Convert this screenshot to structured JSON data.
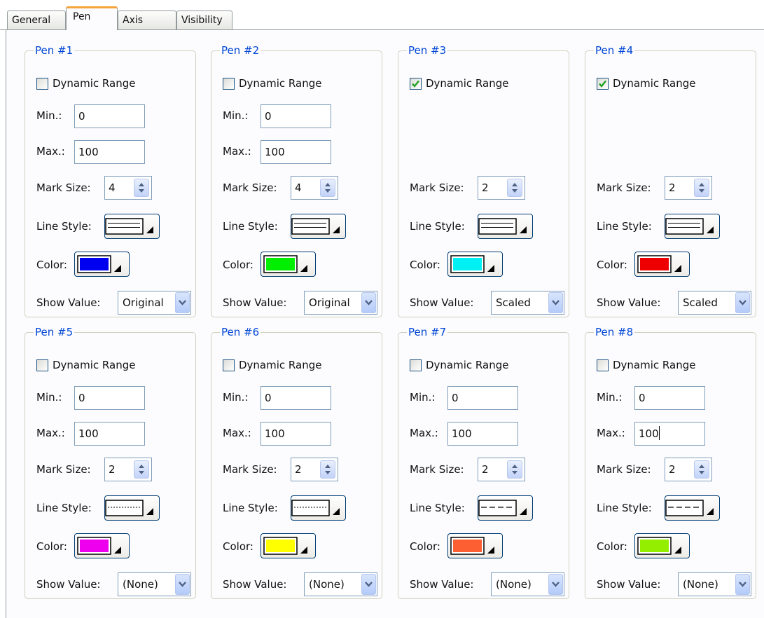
{
  "tabs": [
    {
      "label": "General"
    },
    {
      "label": "Pen",
      "active": true
    },
    {
      "label": "Axis"
    },
    {
      "label": "Visibility"
    }
  ],
  "labels": {
    "dynamic_range": "Dynamic Range",
    "min": "Min.:",
    "max": "Max.:",
    "mark_size": "Mark Size:",
    "line_style": "Line Style:",
    "color": "Color:",
    "show_value": "Show Value:"
  },
  "pens": [
    {
      "title": "Pen #1",
      "dynamic_range": false,
      "min": "0",
      "max": "100",
      "mark_size": "4",
      "line_style": "solid",
      "color": "#0000f0",
      "show_value": "Original"
    },
    {
      "title": "Pen #2",
      "dynamic_range": false,
      "min": "0",
      "max": "100",
      "mark_size": "4",
      "line_style": "solid",
      "color": "#00ee00",
      "show_value": "Original"
    },
    {
      "title": "Pen #3",
      "dynamic_range": true,
      "mark_size": "2",
      "line_style": "solid",
      "color": "#00f0f4",
      "show_value": "Scaled"
    },
    {
      "title": "Pen #4",
      "dynamic_range": true,
      "mark_size": "2",
      "line_style": "solid",
      "color": "#ee0000",
      "show_value": "Scaled"
    },
    {
      "title": "Pen #5",
      "dynamic_range": false,
      "min": "0",
      "max": "100",
      "mark_size": "2",
      "line_style": "dotted",
      "color": "#ee00ee",
      "show_value": "(None)"
    },
    {
      "title": "Pen #6",
      "dynamic_range": false,
      "min": "0",
      "max": "100",
      "mark_size": "2",
      "line_style": "dotted",
      "color": "#ffff00",
      "show_value": "(None)"
    },
    {
      "title": "Pen #7",
      "dynamic_range": false,
      "min": "0",
      "max": "100",
      "mark_size": "2",
      "line_style": "dashed",
      "color": "#fe5f32",
      "show_value": "(None)"
    },
    {
      "title": "Pen #8",
      "dynamic_range": false,
      "min": "0",
      "max": "100",
      "mark_size": "2",
      "line_style": "dashed",
      "color": "#94ee00",
      "show_value": "(None)",
      "focused_field": "max"
    }
  ]
}
